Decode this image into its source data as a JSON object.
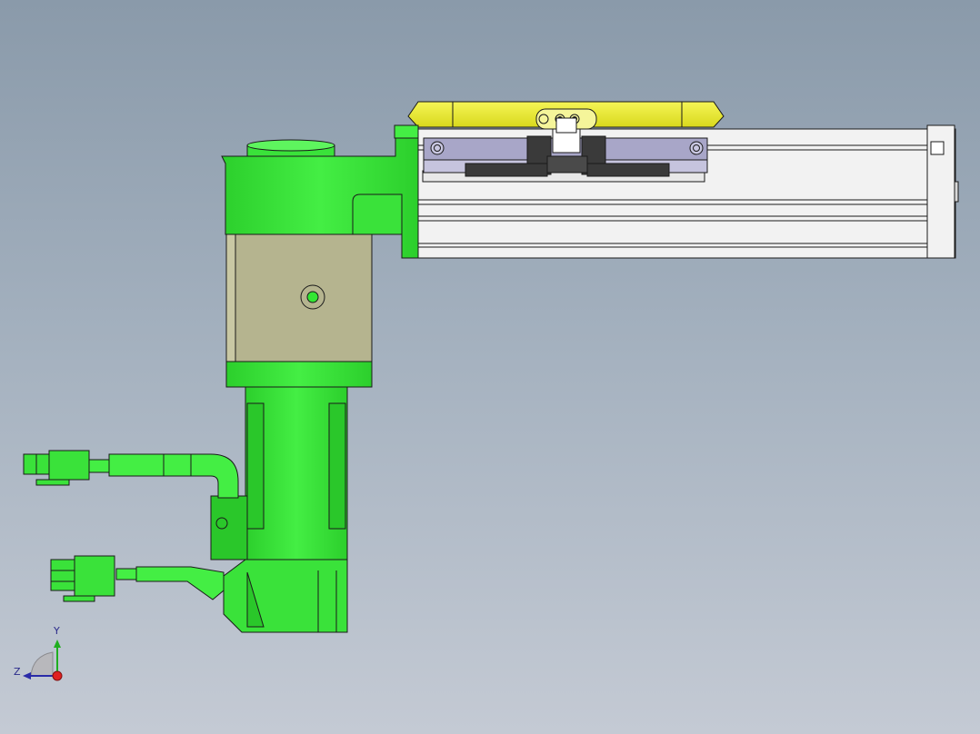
{
  "viewport": {
    "triad": {
      "y_label": "Y",
      "z_label": "Z"
    }
  },
  "colors": {
    "body_green": "#33e633",
    "gearbox_khaki": "#b5b48f",
    "rail_white": "#f2f2f2",
    "carriage_purple": "#a8a6c8",
    "top_yellow": "#f0f030",
    "outline": "#1a1a1a",
    "background_top": "#8a9aaa",
    "background_bottom": "#c4cad4"
  },
  "model": {
    "parts": [
      "motor-body",
      "gearbox-block",
      "top-bracket",
      "linear-rail",
      "slide-carriage",
      "top-plate",
      "cable-upper",
      "cable-lower",
      "connector-upper",
      "connector-lower"
    ]
  }
}
